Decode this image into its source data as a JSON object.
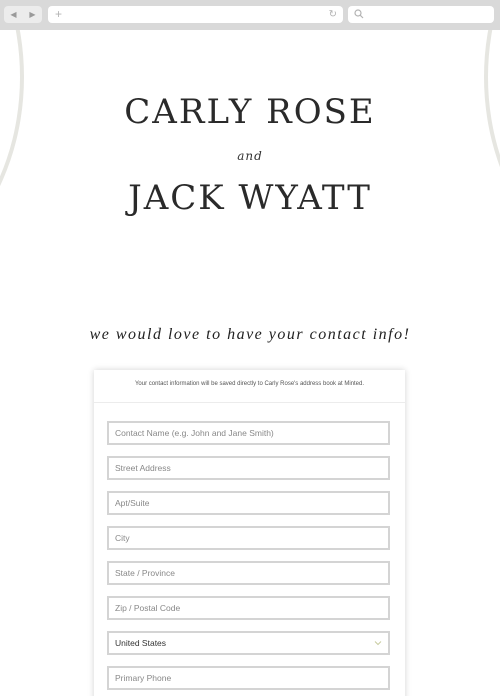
{
  "browser": {
    "back_icon": "back-arrow-icon",
    "forward_icon": "forward-arrow-icon",
    "new_tab_symbol": "+",
    "reload_icon": "reload-icon",
    "search_icon": "search-icon"
  },
  "hero": {
    "name_one": "CARLY ROSE",
    "connector": "and",
    "name_two": "JACK WYATT"
  },
  "tagline": "we would love to have your contact info!",
  "form": {
    "notice": "Your contact information will be saved directly to Carly Rose's address book at Minted.",
    "fields": [
      {
        "placeholder": "Contact Name (e.g. John and Jane Smith)"
      },
      {
        "placeholder": "Street Address"
      },
      {
        "placeholder": "Apt/Suite"
      },
      {
        "placeholder": "City"
      },
      {
        "placeholder": "State / Province"
      },
      {
        "placeholder": "Zip / Postal Code"
      },
      {
        "value": "United States",
        "type": "select"
      },
      {
        "placeholder": "Primary Phone"
      }
    ]
  },
  "colors": {
    "chrome": "#d9d9d9",
    "arc": "#e6e6e1",
    "field_border": "#d4d4d4",
    "chevron": "#c8cca0"
  }
}
